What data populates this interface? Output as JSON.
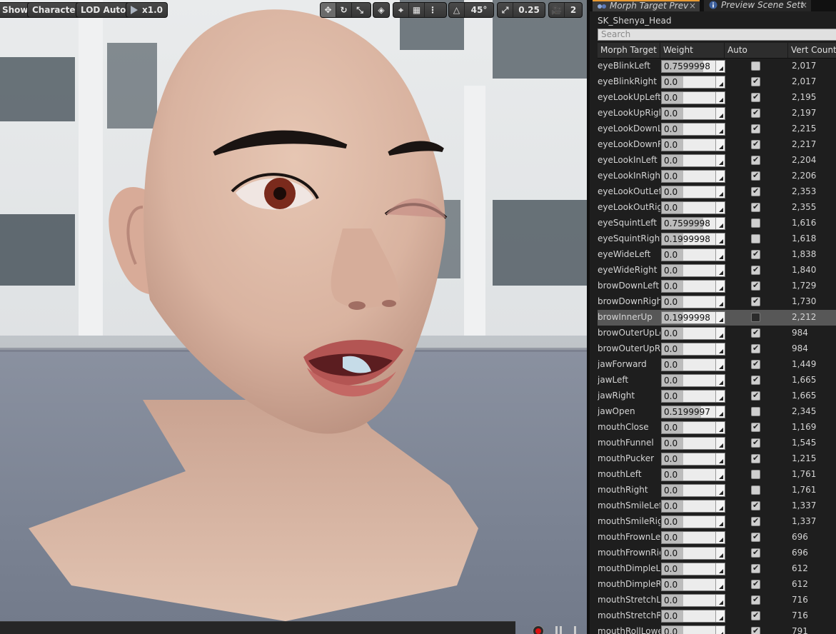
{
  "viewport_toolbar": {
    "show_label": "Show",
    "character_label": "Character",
    "lod_label": "LOD Auto",
    "speed_label": "x1.0",
    "rotation_snap": "45°",
    "scale_snap": "0.25",
    "camera_speed": "2"
  },
  "tabs": [
    {
      "label": "Morph Target Prev",
      "icon": "morph-target-icon"
    },
    {
      "label": "Preview Scene Sett",
      "icon": "info-icon"
    }
  ],
  "panel": {
    "asset_name": "SK_Shenya_Head",
    "search_placeholder": "Search",
    "columns": [
      "Morph Target N",
      "Weight",
      "Auto",
      "Vert Count"
    ]
  },
  "morph_targets": [
    {
      "name": "eyeBlinkLeft",
      "weight": "0.7599998",
      "fill": 0.76,
      "auto": false,
      "verts": "2,017"
    },
    {
      "name": "eyeBlinkRight",
      "weight": "0.0",
      "fill": 0.4,
      "auto": true,
      "verts": "2,017"
    },
    {
      "name": "eyeLookUpLeft",
      "weight": "0.0",
      "fill": 0.4,
      "auto": true,
      "verts": "2,195"
    },
    {
      "name": "eyeLookUpRight",
      "weight": "0.0",
      "fill": 0.4,
      "auto": true,
      "verts": "2,197"
    },
    {
      "name": "eyeLookDownLeft",
      "weight": "0.0",
      "fill": 0.4,
      "auto": true,
      "verts": "2,215"
    },
    {
      "name": "eyeLookDownRight",
      "weight": "0.0",
      "fill": 0.4,
      "auto": true,
      "verts": "2,217"
    },
    {
      "name": "eyeLookInLeft",
      "weight": "0.0",
      "fill": 0.4,
      "auto": true,
      "verts": "2,204"
    },
    {
      "name": "eyeLookInRight",
      "weight": "0.0",
      "fill": 0.4,
      "auto": true,
      "verts": "2,206"
    },
    {
      "name": "eyeLookOutLeft",
      "weight": "0.0",
      "fill": 0.4,
      "auto": true,
      "verts": "2,353"
    },
    {
      "name": "eyeLookOutRight",
      "weight": "0.0",
      "fill": 0.4,
      "auto": true,
      "verts": "2,355"
    },
    {
      "name": "eyeSquintLeft",
      "weight": "0.7599998",
      "fill": 0.76,
      "auto": false,
      "verts": "1,616"
    },
    {
      "name": "eyeSquintRight",
      "weight": "0.1999998",
      "fill": 0.4,
      "auto": false,
      "verts": "1,618"
    },
    {
      "name": "eyeWideLeft",
      "weight": "0.0",
      "fill": 0.4,
      "auto": true,
      "verts": "1,838"
    },
    {
      "name": "eyeWideRight",
      "weight": "0.0",
      "fill": 0.4,
      "auto": true,
      "verts": "1,840"
    },
    {
      "name": "browDownLeft",
      "weight": "0.0",
      "fill": 0.4,
      "auto": true,
      "verts": "1,729"
    },
    {
      "name": "browDownRight",
      "weight": "0.0",
      "fill": 0.4,
      "auto": true,
      "verts": "1,730"
    },
    {
      "name": "browInnerUp",
      "weight": "0.1999998",
      "fill": 0.4,
      "auto": false,
      "verts": "2,212",
      "selected": true
    },
    {
      "name": "browOuterUpLeft",
      "weight": "0.0",
      "fill": 0.4,
      "auto": true,
      "verts": "984"
    },
    {
      "name": "browOuterUpRight",
      "weight": "0.0",
      "fill": 0.4,
      "auto": true,
      "verts": "984"
    },
    {
      "name": "jawForward",
      "weight": "0.0",
      "fill": 0.4,
      "auto": true,
      "verts": "1,449"
    },
    {
      "name": "jawLeft",
      "weight": "0.0",
      "fill": 0.4,
      "auto": true,
      "verts": "1,665"
    },
    {
      "name": "jawRight",
      "weight": "0.0",
      "fill": 0.4,
      "auto": true,
      "verts": "1,665"
    },
    {
      "name": "jawOpen",
      "weight": "0.5199997",
      "fill": 0.72,
      "auto": false,
      "verts": "2,345"
    },
    {
      "name": "mouthClose",
      "weight": "0.0",
      "fill": 0.4,
      "auto": true,
      "verts": "1,169"
    },
    {
      "name": "mouthFunnel",
      "weight": "0.0",
      "fill": 0.4,
      "auto": true,
      "verts": "1,545"
    },
    {
      "name": "mouthPucker",
      "weight": "0.0",
      "fill": 0.4,
      "auto": true,
      "verts": "1,215"
    },
    {
      "name": "mouthLeft",
      "weight": "0.0",
      "fill": 0.4,
      "auto": false,
      "verts": "1,761"
    },
    {
      "name": "mouthRight",
      "weight": "0.0",
      "fill": 0.4,
      "auto": false,
      "verts": "1,761"
    },
    {
      "name": "mouthSmileLeft",
      "weight": "0.0",
      "fill": 0.4,
      "auto": true,
      "verts": "1,337"
    },
    {
      "name": "mouthSmileRight",
      "weight": "0.0",
      "fill": 0.4,
      "auto": true,
      "verts": "1,337"
    },
    {
      "name": "mouthFrownLeft",
      "weight": "0.0",
      "fill": 0.4,
      "auto": true,
      "verts": "696"
    },
    {
      "name": "mouthFrownRight",
      "weight": "0.0",
      "fill": 0.4,
      "auto": true,
      "verts": "696"
    },
    {
      "name": "mouthDimpleLeft",
      "weight": "0.0",
      "fill": 0.4,
      "auto": true,
      "verts": "612"
    },
    {
      "name": "mouthDimpleRight",
      "weight": "0.0",
      "fill": 0.4,
      "auto": true,
      "verts": "612"
    },
    {
      "name": "mouthStretchLeft",
      "weight": "0.0",
      "fill": 0.4,
      "auto": true,
      "verts": "716"
    },
    {
      "name": "mouthStretchRight",
      "weight": "0.0",
      "fill": 0.4,
      "auto": true,
      "verts": "716"
    },
    {
      "name": "mouthRollLower",
      "weight": "0.0",
      "fill": 0.4,
      "auto": true,
      "verts": "791"
    }
  ]
}
